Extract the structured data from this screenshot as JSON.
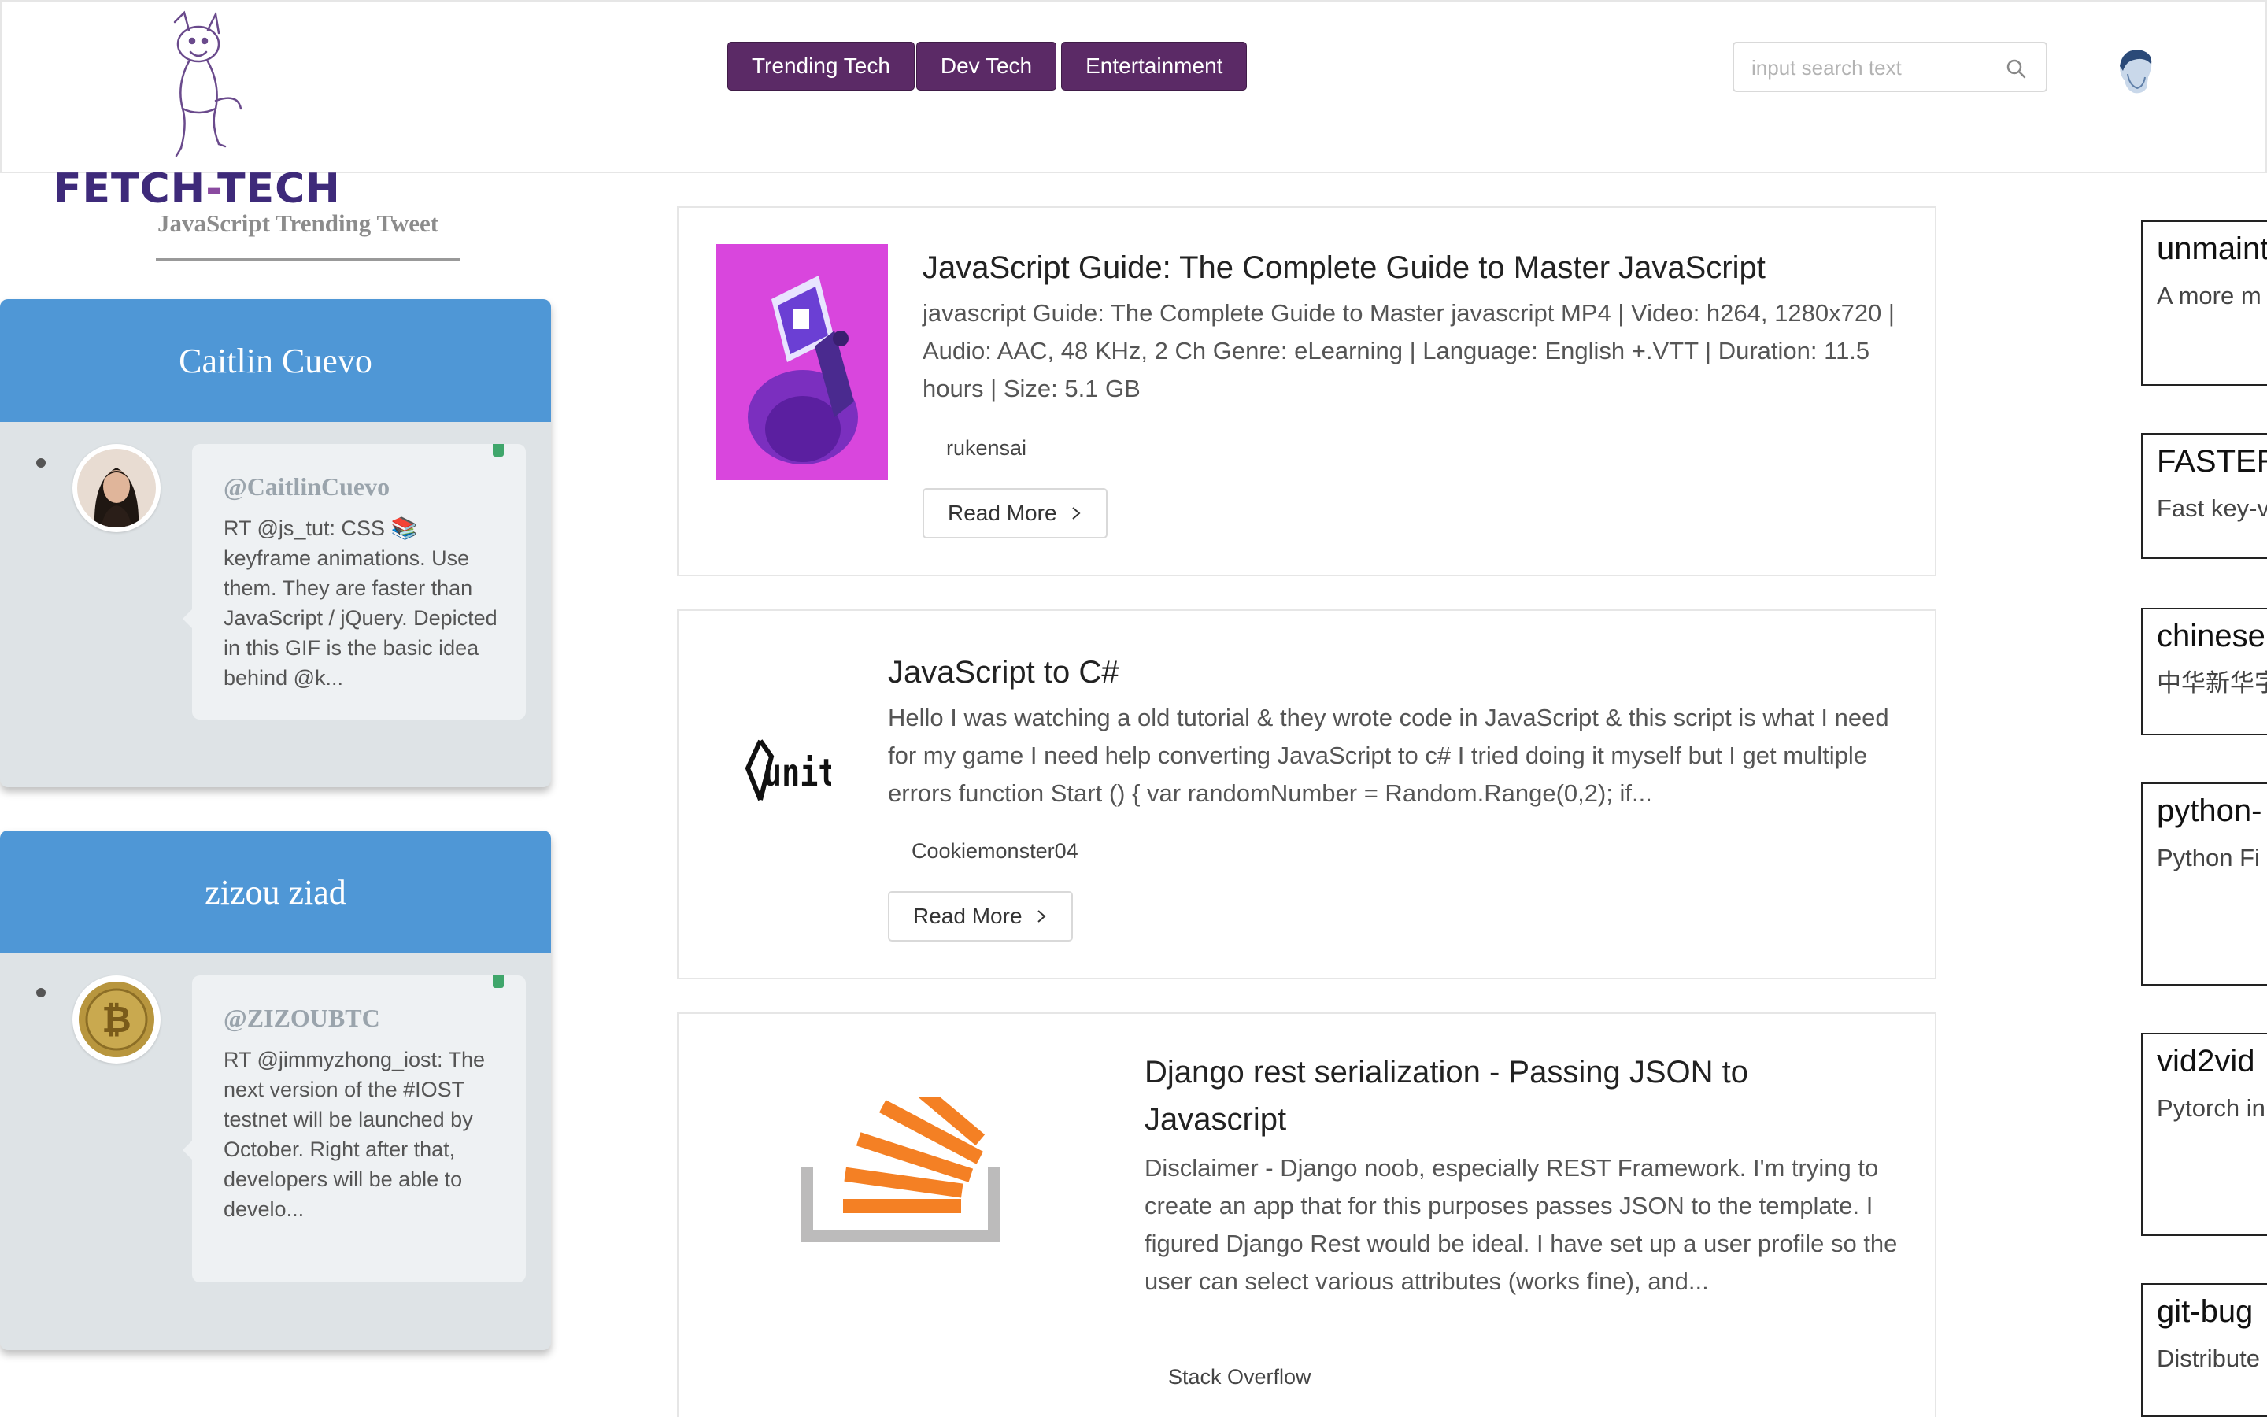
{
  "header": {
    "nav": [
      {
        "label": "Trending Tech"
      },
      {
        "label": "Dev Tech"
      },
      {
        "label": "Entertainment"
      }
    ],
    "search": {
      "placeholder": "input search text"
    }
  },
  "brand": {
    "name_part1": "FETCH",
    "name_dash": "-",
    "name_part2": "TECH",
    "subtitle": "JavaScript Trending Tweet"
  },
  "tweets": [
    {
      "name": "Caitlin Cuevo",
      "handle": "@CaitlinCuevo",
      "text": "RT @js_tut: CSS 📚 keyframe animations. Use them. They are faster than JavaScript / jQuery. Depicted in this GIF is the basic idea behind @k..."
    },
    {
      "name": "zizou ziad",
      "handle": "@ZIZOUBTC",
      "text": "RT @jimmyzhong_iost: The next version of the #IOST testnet will be launched by October. Right after that, developers will be able to develo..."
    }
  ],
  "articles": [
    {
      "title": "JavaScript Guide: The Complete Guide to Master JavaScript",
      "body": "javascript Guide: The Complete Guide to Master javascript MP4 | Video: h264, 1280x720 | Audio: AAC, 48 KHz, 2 Ch Genre: eLearning | Language: English +.VTT | Duration: 11.5 hours | Size: 5.1 GB",
      "author": "rukensai",
      "read_more": "Read More"
    },
    {
      "title": "JavaScript to C#",
      "body": "Hello I was watching a old tutorial & they wrote code in JavaScript & this script is what I need for my game I need help converting JavaScript to c# I tried doing it myself but I get multiple errors function Start () { var randomNumber = Random.Range(0,2); if...",
      "author": "Cookiemonster04",
      "read_more": "Read More"
    },
    {
      "title": "Django rest serialization - Passing JSON to Javascript",
      "body": "Disclaimer - Django noob, especially REST Framework. I'm trying to create an app that for this purposes passes JSON to the template. I figured Django Rest would be ideal. I have set up a user profile so the user can select various attributes (works fine), and...",
      "author": "Stack Overflow"
    }
  ],
  "repos": [
    {
      "title": "unmaint",
      "desc": "A more m version of http://min"
    },
    {
      "title": "FASTER",
      "desc": "Fast key-v Research"
    },
    {
      "title": "chinese",
      "desc": "中华新华字 语，词语，"
    },
    {
      "title": "python-",
      "desc": "Python Fi generatin (CLIs) fro object."
    },
    {
      "title": "vid2vid",
      "desc": "Pytorch in for high-r photoreal translatio"
    },
    {
      "title": "git-bug",
      "desc": "Distribute Git"
    }
  ],
  "colors": {
    "nav_bg": "#5b2a66",
    "tweet_header": "#4f97d6",
    "tweet_card_bg": "#dee3e6",
    "status_dot": "#3fa66b"
  }
}
